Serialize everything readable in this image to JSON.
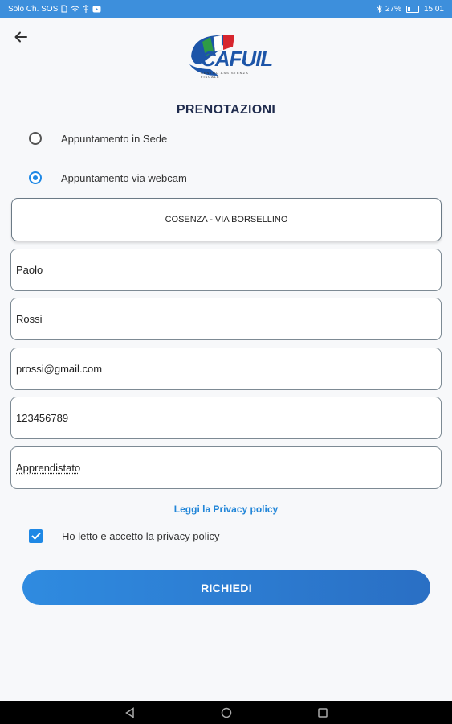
{
  "status_bar": {
    "carrier": "Solo Ch. SOS",
    "battery": "27%",
    "time": "15:01"
  },
  "header": {
    "logo_text": "CAFUIL",
    "logo_subtext": "CENTRO ASSISTENZA FISCALE"
  },
  "page": {
    "title": "PRENOTAZIONI"
  },
  "appointment_options": [
    {
      "label": "Appuntamento in Sede",
      "selected": false
    },
    {
      "label": "Appuntamento via webcam",
      "selected": true
    }
  ],
  "location": {
    "value": "COSENZA - VIA BORSELLINO"
  },
  "form": {
    "first_name": "Paolo",
    "last_name": "Rossi",
    "email": "prossi@gmail.com",
    "phone": "123456789",
    "subject": "Apprendistato"
  },
  "privacy": {
    "link_label": "Leggi la Privacy policy",
    "accept_label": "Ho letto e accetto la privacy policy",
    "accepted": true
  },
  "submit": {
    "label": "RICHIEDI"
  },
  "colors": {
    "accent": "#1e88e5",
    "status_bar": "#3d8fdc",
    "title": "#1f2b4d"
  }
}
